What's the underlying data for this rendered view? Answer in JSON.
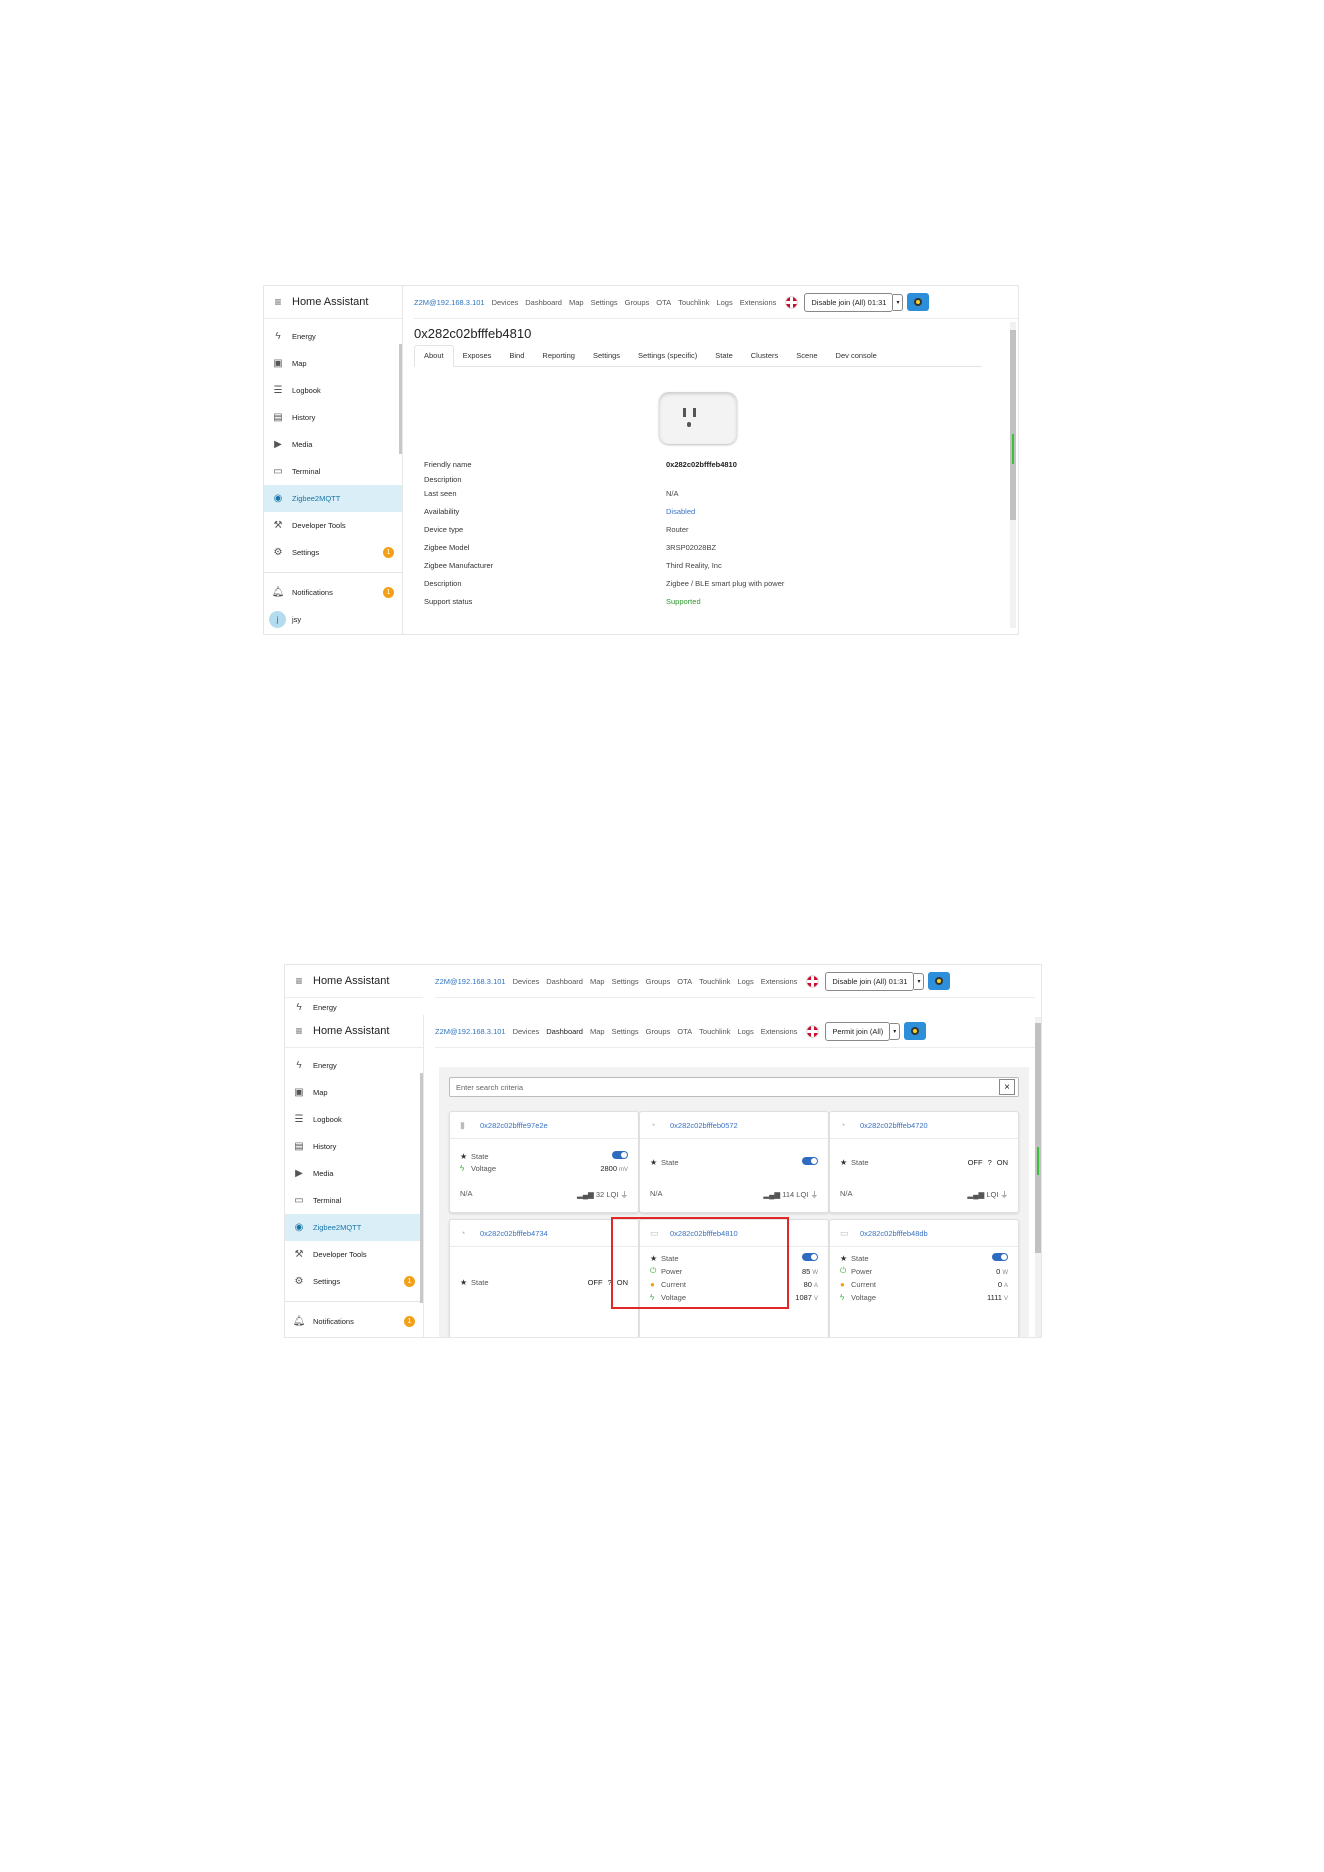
{
  "app_title": "Home Assistant",
  "sidebar": {
    "items": [
      {
        "label": "Energy",
        "icon": "lightning-icon"
      },
      {
        "label": "Map",
        "icon": "map-icon"
      },
      {
        "label": "Logbook",
        "icon": "list-icon"
      },
      {
        "label": "History",
        "icon": "chart-icon"
      },
      {
        "label": "Media",
        "icon": "media-icon"
      },
      {
        "label": "Terminal",
        "icon": "terminal-icon"
      },
      {
        "label": "Zigbee2MQTT",
        "icon": "zigbee-icon",
        "active": true
      },
      {
        "label": "Developer Tools",
        "icon": "hammer-icon"
      },
      {
        "label": "Settings",
        "icon": "gear-icon",
        "badge": "1"
      }
    ],
    "notifications": {
      "label": "Notifications",
      "badge": "1"
    },
    "user": {
      "initial": "j",
      "name": "jsy"
    }
  },
  "topnav": {
    "brand": "Z2M@192.168.3.101",
    "links": [
      "Devices",
      "Dashboard",
      "Map",
      "Settings",
      "Groups",
      "OTA",
      "Touchlink",
      "Logs",
      "Extensions"
    ],
    "join_button_1": "Disable join (All) 01:31",
    "join_button_2": "Permit join (All)",
    "dropdown": "▾"
  },
  "device_page": {
    "title": "0x282c02bfffeb4810",
    "tabs": [
      "About",
      "Exposes",
      "Bind",
      "Reporting",
      "Settings",
      "Settings (specific)",
      "State",
      "Clusters",
      "Scene",
      "Dev console"
    ],
    "rows": [
      {
        "key": "Friendly name",
        "value": "0x282c02bfffeb4810"
      },
      {
        "key": "Description",
        "value": ""
      },
      {
        "key": "Last seen",
        "value": "N/A"
      },
      {
        "key": "Availability",
        "value": "Disabled"
      },
      {
        "key": "Device type",
        "value": "Router"
      },
      {
        "key": "Zigbee Model",
        "value": "3RSP02028BZ"
      },
      {
        "key": "Zigbee Manufacturer",
        "value": "Third Reality, Inc"
      },
      {
        "key": "Description",
        "value": "Zigbee / BLE smart plug with power"
      },
      {
        "key": "Support status",
        "value": "Supported"
      }
    ]
  },
  "dashboard": {
    "search_placeholder": "Enter search criteria",
    "clear": "×",
    "cards": [
      {
        "name": "0x282c02bfffe97e2e",
        "props": [
          {
            "label": "State",
            "value": "",
            "kind": "toggle"
          },
          {
            "label": "Voltage",
            "value": "2800",
            "unit": "mV"
          }
        ],
        "footer_left": "N/A",
        "footer_right": "32 LQI"
      },
      {
        "name": "0x282c02bfffeb0572",
        "props": [
          {
            "label": "State",
            "value": "",
            "kind": "toggle"
          }
        ],
        "footer_left": "N/A",
        "footer_right": "114 LQI"
      },
      {
        "name": "0x282c02bfffeb4720",
        "props": [
          {
            "label": "State",
            "value": "",
            "kind": "offon"
          }
        ],
        "footer_left": "N/A",
        "footer_right": "LQI"
      },
      {
        "name": "0x282c02bfffeb4734",
        "props": [
          {
            "label": "State",
            "value": "",
            "kind": "offon"
          }
        ]
      },
      {
        "name": "0x282c02bfffeb4810",
        "props": [
          {
            "label": "State",
            "value": "",
            "kind": "toggle"
          },
          {
            "label": "Power",
            "value": "85",
            "unit": "W"
          },
          {
            "label": "Current",
            "value": "80",
            "unit": "A"
          },
          {
            "label": "Voltage",
            "value": "1087",
            "unit": "V"
          }
        ]
      },
      {
        "name": "0x282c02bfffeb48db",
        "props": [
          {
            "label": "State",
            "value": "",
            "kind": "toggle"
          },
          {
            "label": "Power",
            "value": "0",
            "unit": "W"
          },
          {
            "label": "Current",
            "value": "0",
            "unit": "A"
          },
          {
            "label": "Voltage",
            "value": "1111",
            "unit": "V"
          }
        ]
      }
    ],
    "off_label": "OFF",
    "q_label": "?",
    "on_label": "ON"
  },
  "colors": {
    "accent": "#2f74c0",
    "active_bg": "#d9eef7",
    "badge": "#f2a017",
    "highlight": "#e02828"
  }
}
